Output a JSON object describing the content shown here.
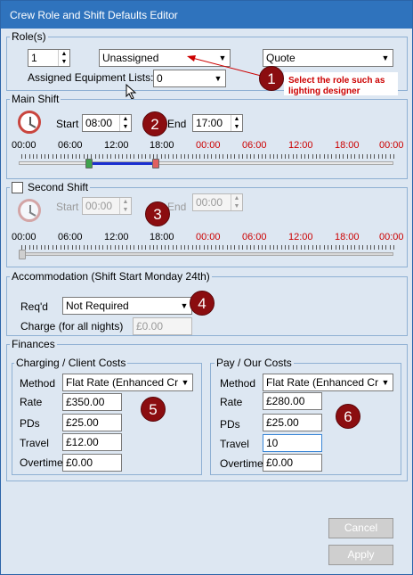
{
  "window": {
    "title": "Crew Role and Shift Defaults Editor"
  },
  "roles": {
    "legend": "Role(s)",
    "quantity": "1",
    "role_value": "Unassigned",
    "rate_type": "Quote",
    "equipment_label": "Assigned Equipment Lists:",
    "equipment_value": "0",
    "annotation": "Select the role such as lighting designer"
  },
  "main_shift": {
    "legend": "Main Shift",
    "start_label": "Start",
    "start_value": "08:00",
    "end_label": "End",
    "end_value": "17:00",
    "range_start_fraction": 0.181,
    "range_end_fraction": 0.362
  },
  "second_shift": {
    "legend": "Second Shift",
    "start_label": "Start",
    "start_value": "00:00",
    "end_label": "End",
    "end_value": "00:00",
    "checked": false
  },
  "timeline_labels": [
    {
      "text": "00:00",
      "color": "#000000"
    },
    {
      "text": "06:00",
      "color": "#000000"
    },
    {
      "text": "12:00",
      "color": "#000000"
    },
    {
      "text": "18:00",
      "color": "#000000"
    },
    {
      "text": "00:00",
      "color": "#cc0000"
    },
    {
      "text": "06:00",
      "color": "#cc0000"
    },
    {
      "text": "12:00",
      "color": "#cc0000"
    },
    {
      "text": "18:00",
      "color": "#cc0000"
    },
    {
      "text": "00:00",
      "color": "#cc0000"
    }
  ],
  "accommodation": {
    "legend": "Accommodation (Shift Start Monday 24th)",
    "reqd_label": "Req'd",
    "reqd_value": "Not Required",
    "charge_label": "Charge (for all nights)",
    "charge_value": "£0.00"
  },
  "finances": {
    "legend": "Finances",
    "charging": {
      "legend": "Charging / Client Costs",
      "method_label": "Method",
      "method_value": "Flat Rate (Enhanced Crew",
      "rate_label": "Rate",
      "rate_value": "£350.00",
      "pds_label": "PDs",
      "pds_value": "£25.00",
      "travel_label": "Travel",
      "travel_value": "£12.00",
      "overtime_label": "Overtime",
      "overtime_value": "£0.00"
    },
    "pay": {
      "legend": "Pay / Our Costs",
      "method_label": "Method",
      "method_value": "Flat Rate (Enhanced Crew",
      "rate_label": "Rate",
      "rate_value": "£280.00",
      "pds_label": "PDs",
      "pds_value": "£25.00",
      "travel_label": "Travel",
      "travel_value": "10",
      "overtime_label": "Overtime",
      "overtime_value": "£0.00"
    }
  },
  "badges": [
    "1",
    "2",
    "3",
    "4",
    "5",
    "6"
  ],
  "buttons": {
    "cancel": "Cancel",
    "apply": "Apply"
  },
  "colors": {
    "titlebar": "#2f73bd",
    "badge": "#8b0d10",
    "range": "#1a2fd0",
    "annotation": "#cc0000"
  }
}
